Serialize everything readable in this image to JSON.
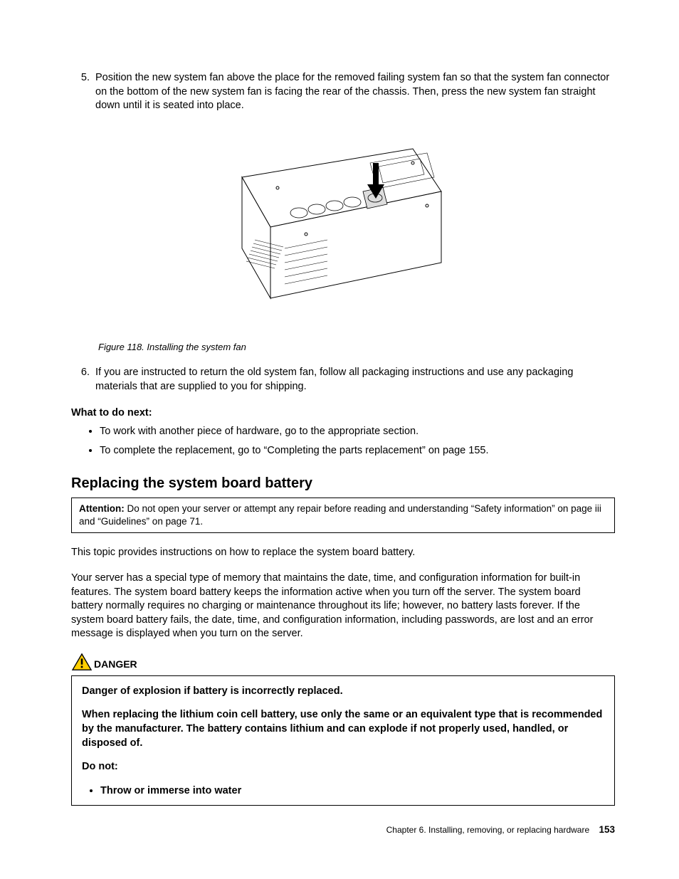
{
  "steps": {
    "s5": {
      "num": "5.",
      "text": "Position the new system fan above the place for the removed failing system fan so that the system fan connector on the bottom of the new system fan is facing the rear of the chassis. Then, press the new system fan straight down until it is seated into place."
    },
    "s6": {
      "num": "6.",
      "text": "If you are instructed to return the old system fan, follow all packaging instructions and use any packaging materials that are supplied to you for shipping."
    }
  },
  "figure": {
    "caption": "Figure 118.  Installing the system fan"
  },
  "next": {
    "heading": "What to do next:",
    "b1": "To work with another piece of hardware, go to the appropriate section.",
    "b2": "To complete the replacement, go to “Completing the parts replacement” on page 155."
  },
  "section": {
    "title": "Replacing the system board battery",
    "attention_label": "Attention:",
    "attention_text": " Do not open your server or attempt any repair before reading and understanding “Safety information” on page iii and “Guidelines” on page 71.",
    "p1": "This topic provides instructions on how to replace the system board battery.",
    "p2": "Your server has a special type of memory that maintains the date, time, and configuration information for built-in features. The system board battery keeps the information active when you turn off the server. The system board battery normally requires no charging or maintenance throughout its life; however, no battery lasts forever. If the system board battery fails, the date, time, and configuration information, including passwords, are lost and an error message is displayed when you turn on the server."
  },
  "danger": {
    "label": "DANGER",
    "l1": "Danger of explosion if battery is incorrectly replaced.",
    "l2": "When replacing the lithium coin cell battery, use only the same or an equivalent type that is recommended by the manufacturer. The battery contains lithium and can explode if not properly used, handled, or disposed of.",
    "l3": "Do not:",
    "b1": "Throw or immerse into water"
  },
  "footer": {
    "chapter": "Chapter 6.  Installing, removing, or replacing hardware",
    "page": "153"
  }
}
